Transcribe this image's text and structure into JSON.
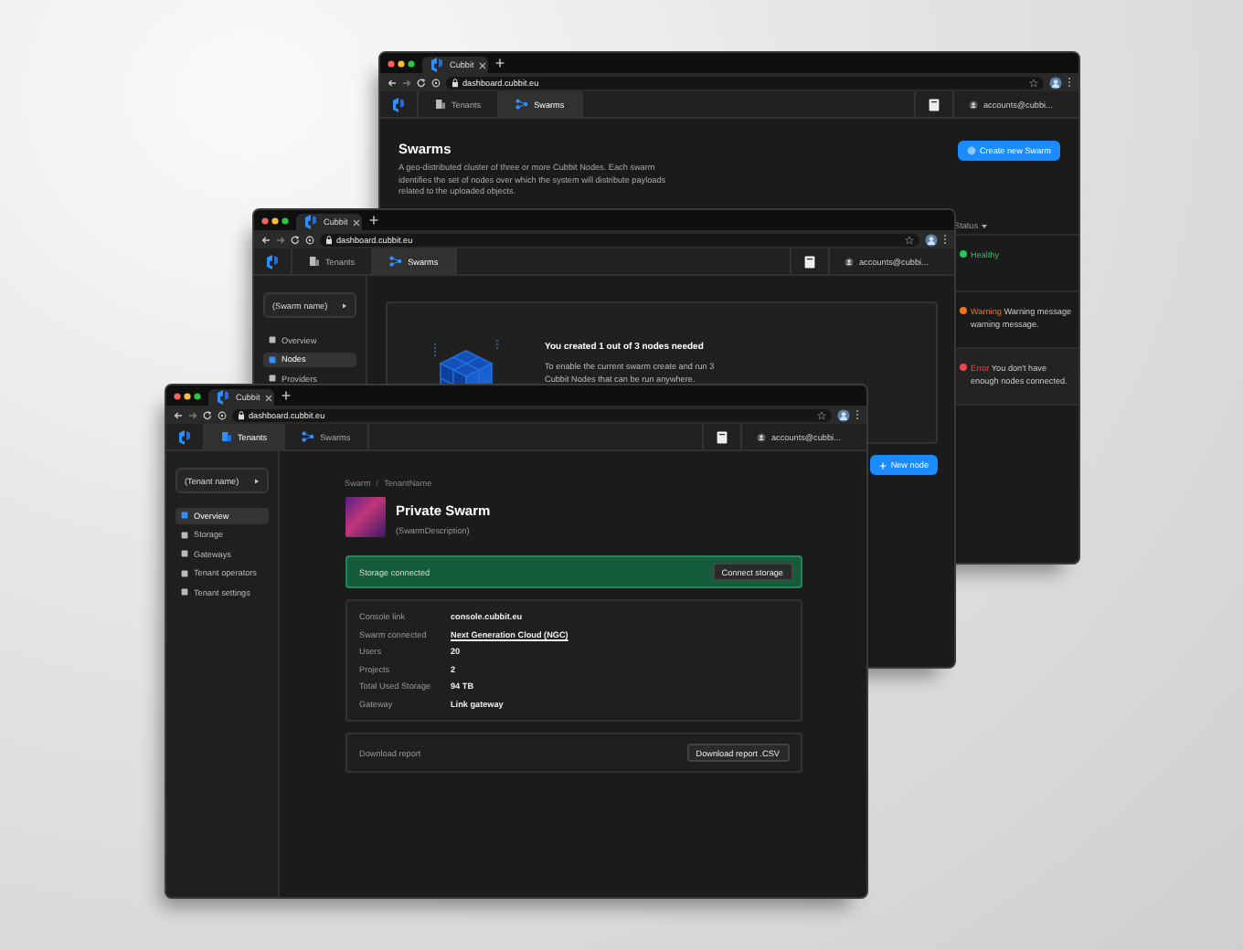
{
  "windows": [
    {
      "kind": "swarm-list",
      "tab_title": "Cubbit",
      "url": "dashboard.cubbit.eu",
      "nav_tabs": [
        {
          "label": "Tenants",
          "selected": false
        },
        {
          "label": "Swarms",
          "selected": true
        }
      ],
      "account": "accounts@cubbi...",
      "page": {
        "title": "Swarms",
        "description": "A geo-distributed cluster of three or more Cubbit Nodes. Each swarm identifies the set of nodes over which the system will distribute payloads related to the uploaded objects.",
        "button": "Create new Swarm",
        "column_header": "Status",
        "rows": [
          {
            "status": "Healthy",
            "color": "#22c55e"
          },
          {
            "status": "Warning",
            "message": "Warning message warning message.",
            "color": "#f97316"
          },
          {
            "status": "Error",
            "message": "You don't have enough nodes connected.",
            "color": "#ef4444"
          }
        ]
      }
    },
    {
      "kind": "swarm-nodes",
      "tab_title": "Cubbit",
      "url": "dashboard.cubbit.eu",
      "nav_tabs": [
        {
          "label": "Tenants",
          "selected": false
        },
        {
          "label": "Swarms",
          "selected": true
        }
      ],
      "account": "accounts@cubbi...",
      "sidebar": {
        "select": "(Swarm name)",
        "items": [
          {
            "label": "Overview",
            "selected": false
          },
          {
            "label": "Nodes",
            "selected": true
          },
          {
            "label": "Providers",
            "selected": false
          }
        ]
      },
      "page": {
        "empty_title": "You created 1 out of 3 nodes needed",
        "empty_text": "To enable the current swarm create and run 3 Cubbit Nodes that can be run anywhere.",
        "button": "New node"
      }
    },
    {
      "kind": "tenant-overview",
      "tab_title": "Cubbit",
      "url": "dashboard.cubbit.eu",
      "nav_tabs": [
        {
          "label": "Tenants",
          "selected": true
        },
        {
          "label": "Swarms",
          "selected": false
        }
      ],
      "account": "accounts@cubbi...",
      "sidebar": {
        "select": "(Tenant name)",
        "items": [
          {
            "label": "Overview",
            "selected": true
          },
          {
            "label": "Storage",
            "selected": false
          },
          {
            "label": "Gateways",
            "selected": false
          },
          {
            "label": "Tenant operators",
            "selected": false
          },
          {
            "label": "Tenant settings",
            "selected": false
          }
        ]
      },
      "page": {
        "breadcrumb": [
          "Swarm",
          "TenantName"
        ],
        "breadcrumb_separator": "/",
        "title": "Private Swarm",
        "description": "(SwarmDescription)",
        "alert": {
          "text": "Storage connected",
          "button": "Connect storage"
        },
        "details": [
          {
            "label": "Console link",
            "value": "console.cubbit.eu",
            "kind": "plain"
          },
          {
            "label": "Swarm connected",
            "value": "Next Generation Cloud (NGC)",
            "kind": "link"
          },
          {
            "label": "Users",
            "value": "20",
            "kind": "plain"
          },
          {
            "label": "Projects",
            "value": "2",
            "kind": "plain"
          },
          {
            "label": "Total Used Storage",
            "value": "94 TB",
            "kind": "plain"
          },
          {
            "label": "Gateway",
            "value": "Link gateway",
            "kind": "plain"
          }
        ],
        "report": {
          "label": "Download report",
          "button": "Download report .CSV"
        }
      }
    }
  ]
}
